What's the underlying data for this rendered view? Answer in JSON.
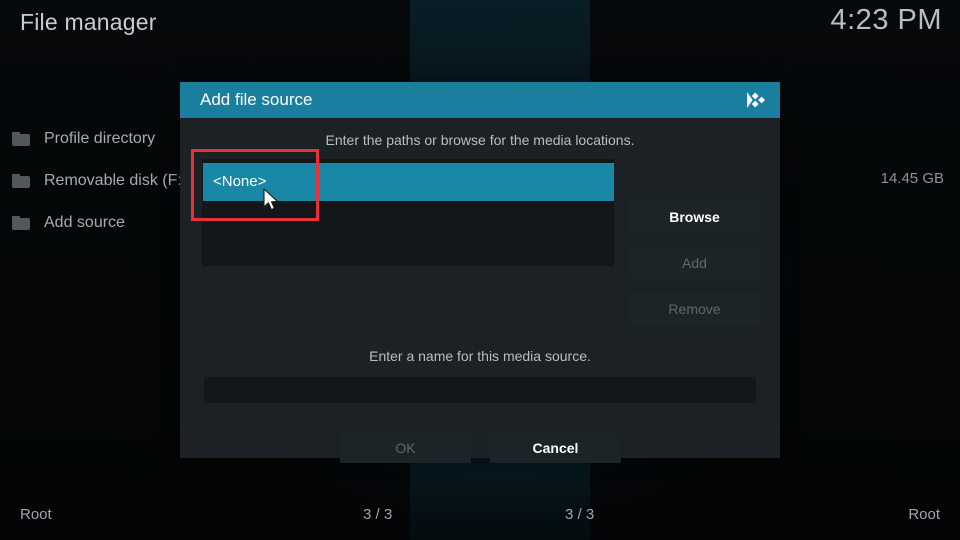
{
  "window": {
    "app_title": "File manager",
    "clock": "4:23 PM"
  },
  "left_pane": {
    "items": [
      {
        "icon": "folder-icon",
        "label": "Profile directory"
      },
      {
        "icon": "folder-icon",
        "label": "Removable disk (F:)"
      },
      {
        "icon": "folder-icon",
        "label": "Add source"
      }
    ],
    "size_label": "14.45 GB"
  },
  "statusbar": {
    "left_path": "Root",
    "left_count": "3 / 3",
    "right_count": "3 / 3",
    "right_path": "Root"
  },
  "dialog": {
    "title": "Add file source",
    "logo_icon": "kodi-logo-icon",
    "paths_hint": "Enter the paths or browse for the media locations.",
    "path_list": {
      "selected_value": "<None>",
      "items": [
        "<None>"
      ]
    },
    "side_buttons": [
      {
        "label": "Browse",
        "enabled": true
      },
      {
        "label": "Add",
        "enabled": false
      },
      {
        "label": "Remove",
        "enabled": false
      }
    ],
    "name_hint": "Enter a name for this media source.",
    "name_input": {
      "value": "",
      "placeholder": ""
    },
    "footer_buttons": [
      {
        "label": "OK",
        "enabled": false
      },
      {
        "label": "Cancel",
        "enabled": true
      }
    ]
  },
  "annotation": {
    "highlight_color": "#e8303a",
    "cursor_icon": "mouse-pointer-icon"
  },
  "theme": {
    "accent": "#1a7f9e",
    "selection": "#1a87a6",
    "dialog_bg": "#1b2124",
    "list_bg": "#141719",
    "text_primary": "#ffffff",
    "text_muted": "#a7abad",
    "text_disabled": "#60686c"
  }
}
